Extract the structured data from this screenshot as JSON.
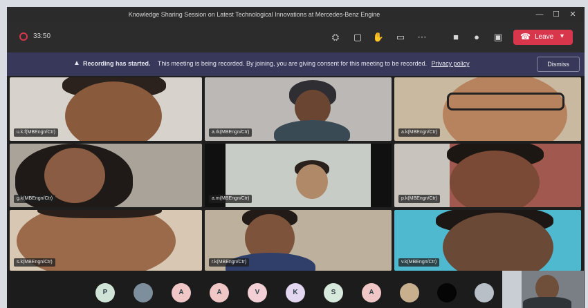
{
  "window": {
    "title": "Knowledge Sharing Session on Latest Technological Innovations at Mercedes-Benz Engine",
    "min": "—",
    "max": "☐",
    "close": "✕"
  },
  "toolbar": {
    "timer": "33:50",
    "icons": [
      "participants-icon",
      "chat-icon",
      "raise-hand-icon",
      "rooms-icon",
      "more-icon",
      "camera-icon",
      "mic-icon",
      "share-icon"
    ],
    "leave_label": "Leave"
  },
  "banner": {
    "title": "Recording has started.",
    "message": "This meeting is being recorded. By joining, you are giving consent for this meeting to be recorded.",
    "link": "Privacy policy",
    "dismiss": "Dismiss"
  },
  "participants": [
    {
      "name": "u.k.f(MBEngn/Ctr)",
      "bg": "#d7d2cc",
      "skin": "#8a5a3c"
    },
    {
      "name": "a.rk(MBEngn/Ctr)",
      "bg": "#bcb8b6",
      "skin": "#6a4632"
    },
    {
      "name": "a.k(MBEngn/Ctr)",
      "bg": "#c9b9a0",
      "skin": "#b7835e"
    },
    {
      "name": "g.k(MBEngn/Ctr)",
      "bg": "#a9a39a",
      "skin": "#8a5c43"
    },
    {
      "name": "a.m(MBEngn/Ctr)",
      "bg": "#c7cdc6",
      "skin": "#b08968"
    },
    {
      "name": "p.k(MBEngn/Ctr)",
      "bg": "#a1584f",
      "skin": "#7a4a36"
    },
    {
      "name": "s.k(MBEngn/Ctr)",
      "bg": "#d8c7b3",
      "skin": "#9a6a4b"
    },
    {
      "name": "r.k(MBEngn/Ctr)",
      "bg": "#bdb09c",
      "skin": "#7d543b"
    },
    {
      "name": "v.k(MBEngn/Ctr)",
      "bg": "#4fb9cf",
      "skin": "#6a4a36"
    }
  ],
  "avatars": [
    "P",
    "",
    "A",
    "A",
    "V",
    "K",
    "S",
    "A",
    "",
    "",
    "",
    ""
  ]
}
